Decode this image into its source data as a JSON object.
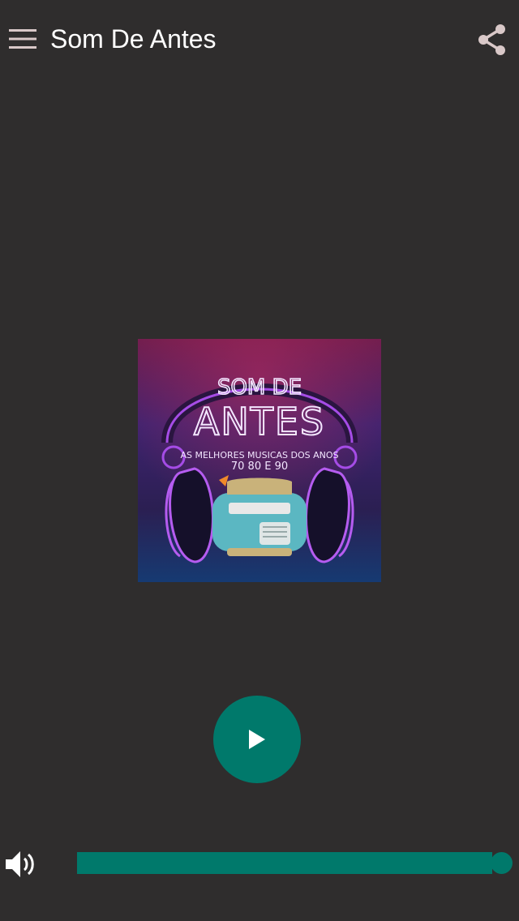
{
  "app_bar": {
    "title": "Som De Antes",
    "menu_icon": "hamburger-menu-icon",
    "share_icon": "share-icon"
  },
  "cover": {
    "line1": "SOM DE",
    "line2": "ANTES",
    "tagline1": "AS MELHORES MUSICAS DOS ANOS",
    "tagline2": "70 80 E 90"
  },
  "player": {
    "play_icon": "play-icon",
    "volume_icon": "volume-icon",
    "volume_level": 1.0
  },
  "colors": {
    "background": "#2f2d2d",
    "accent": "#00796b",
    "icon": "#d9c8c8"
  }
}
